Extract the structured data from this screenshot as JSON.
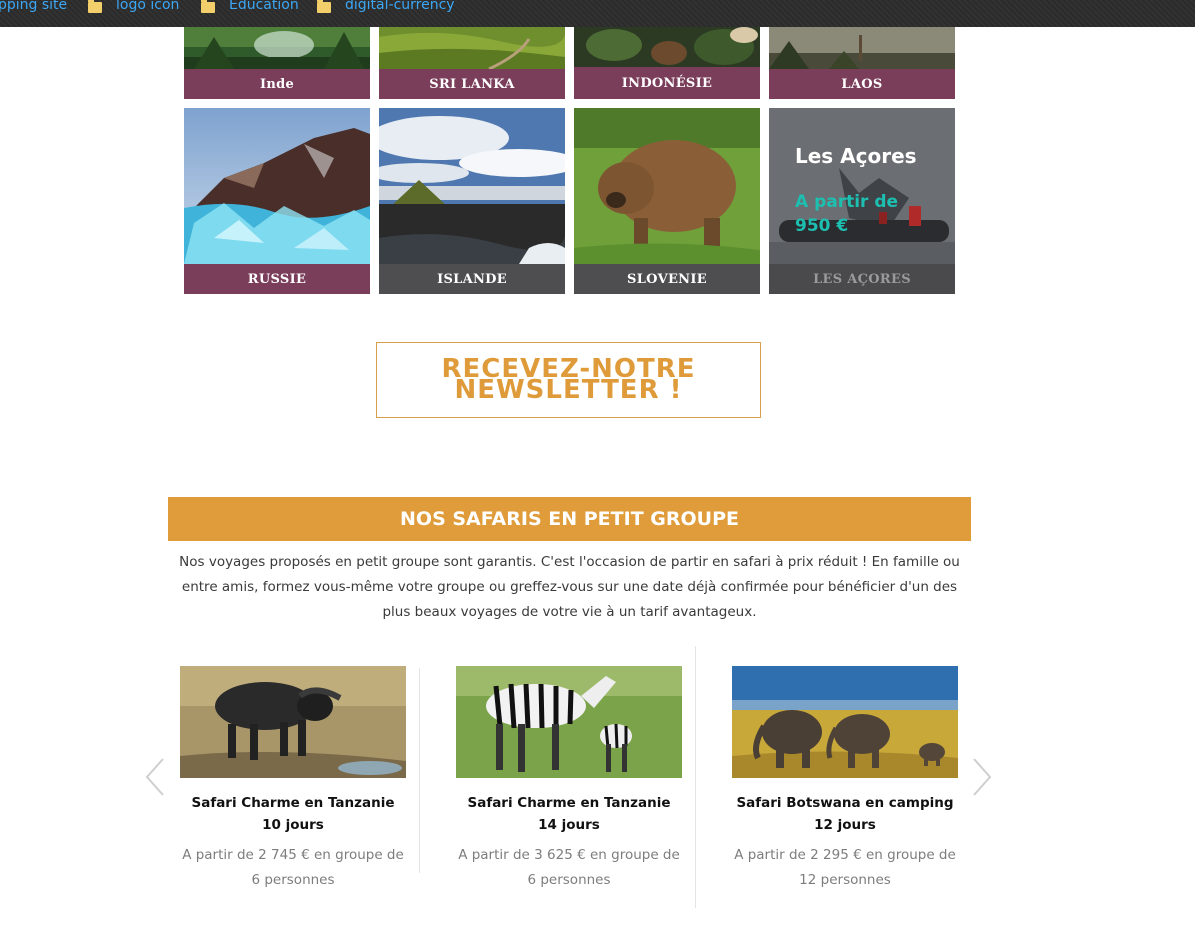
{
  "bookmarks": [
    {
      "label": "pping site",
      "icon": "none"
    },
    {
      "label": "logo icon",
      "icon": "folder-icon"
    },
    {
      "label": "Education",
      "icon": "folder-icon"
    },
    {
      "label": "digital-currency",
      "icon": "folder-icon"
    }
  ],
  "destinations": [
    {
      "name": "Inde"
    },
    {
      "name": "SRI LANKA"
    },
    {
      "name": "INDONÉSIE"
    },
    {
      "name": "LAOS"
    },
    {
      "name": "RUSSIE"
    },
    {
      "name": "ISLANDE"
    },
    {
      "name": "SLOVENIE"
    },
    {
      "name": "LES AÇORES",
      "promo_title": "Les Açores",
      "promo_price_line1": "A partir de",
      "promo_price_line2": "950 €"
    }
  ],
  "newsletter": {
    "label": "RECEVEZ-NOTRE NEWSLETTER !"
  },
  "safaris": {
    "heading": "NOS SAFARIS EN PETIT GROUPE",
    "intro": "Nos voyages proposés en petit groupe sont garantis. C'est l'occasion de partir en safari à prix réduit ! En famille ou entre amis, formez vous-même votre groupe ou greffez-vous sur une date déjà confirmée pour bénéficier d'un des plus beaux voyages de votre vie à un tarif avantageux.",
    "cards": [
      {
        "title": "Safari Charme en Tanzanie 10 jours",
        "price": "A partir de 2 745 € en groupe de 6 personnes",
        "image": "buffalo"
      },
      {
        "title": "Safari Charme en Tanzanie 14 jours",
        "price": "A partir de 3 625 € en groupe de 6 personnes",
        "image": "zebras"
      },
      {
        "title": "Safari Botswana en camping 12 jours",
        "price": "A partir de 2 295 € en groupe de 12 personnes",
        "image": "elephants"
      }
    ]
  },
  "colors": {
    "accent": "#e09c3a",
    "plum": "#7a3d5a",
    "grey_label": "#4e4e50",
    "link": "#3ba7f5"
  }
}
